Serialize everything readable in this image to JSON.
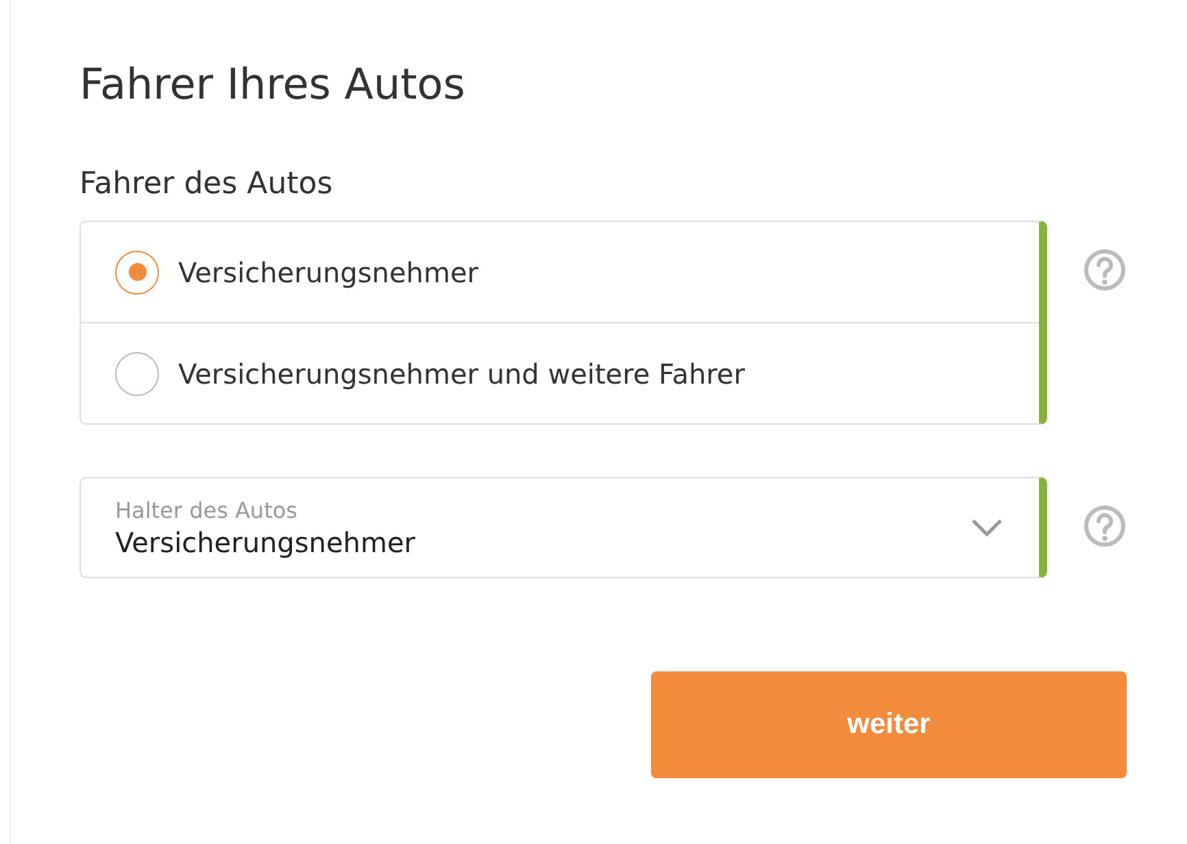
{
  "title": "Fahrer Ihres Autos",
  "driver_group": {
    "label": "Fahrer des Autos",
    "valid": true,
    "options": [
      {
        "label": "Versicherungsnehmer",
        "selected": true
      },
      {
        "label": "Versicherungsnehmer und weitere Fahrer",
        "selected": false
      }
    ]
  },
  "holder_select": {
    "label": "Halter des Autos",
    "value": "Versicherungsnehmer",
    "valid": true
  },
  "next_button": {
    "label": "weiter"
  }
}
